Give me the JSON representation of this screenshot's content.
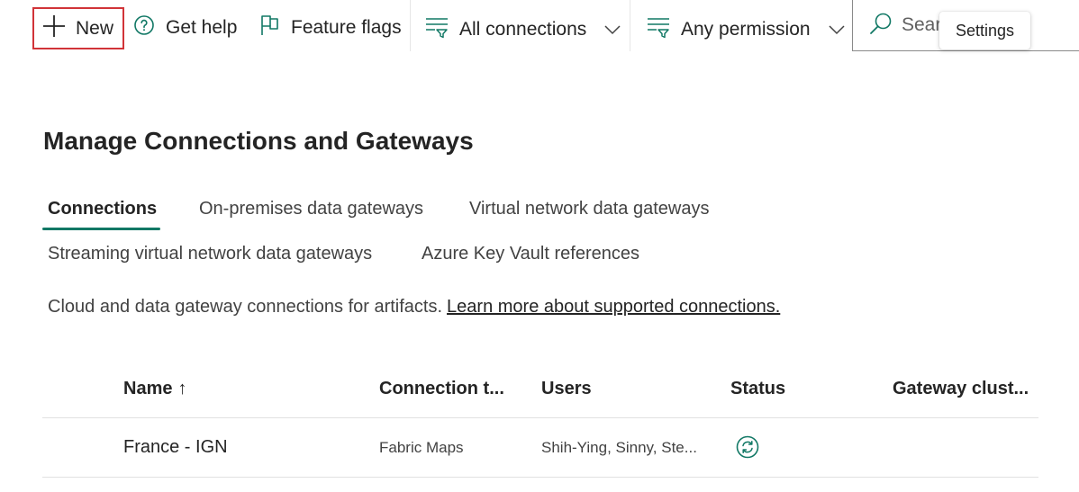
{
  "toolbar": {
    "new_label": "New",
    "help_label": "Get help",
    "flags_label": "Feature flags",
    "filter_connections": "All connections",
    "filter_permission": "Any permission",
    "search_placeholder": "Search",
    "tooltip": "Settings"
  },
  "page": {
    "title": "Manage Connections and Gateways",
    "tabs": [
      {
        "label": "Connections",
        "active": true
      },
      {
        "label": "On-premises data gateways",
        "active": false
      },
      {
        "label": "Virtual network data gateways",
        "active": false
      },
      {
        "label": "Streaming virtual network data gateways",
        "active": false
      },
      {
        "label": "Azure Key Vault references",
        "active": false
      }
    ],
    "description": "Cloud and data gateway connections for artifacts.",
    "learn_more": "Learn more about supported connections."
  },
  "table": {
    "columns": [
      "Name",
      "Connection t...",
      "Users",
      "Status",
      "Gateway clust..."
    ],
    "sort_indicator": "↑",
    "rows": [
      {
        "name": "France - IGN",
        "type": "Fabric Maps",
        "users": "Shih-Ying, Sinny, Ste...",
        "status": "refresh-icon"
      }
    ]
  },
  "colors": {
    "accent": "#117865",
    "highlight_box": "#d13438"
  }
}
